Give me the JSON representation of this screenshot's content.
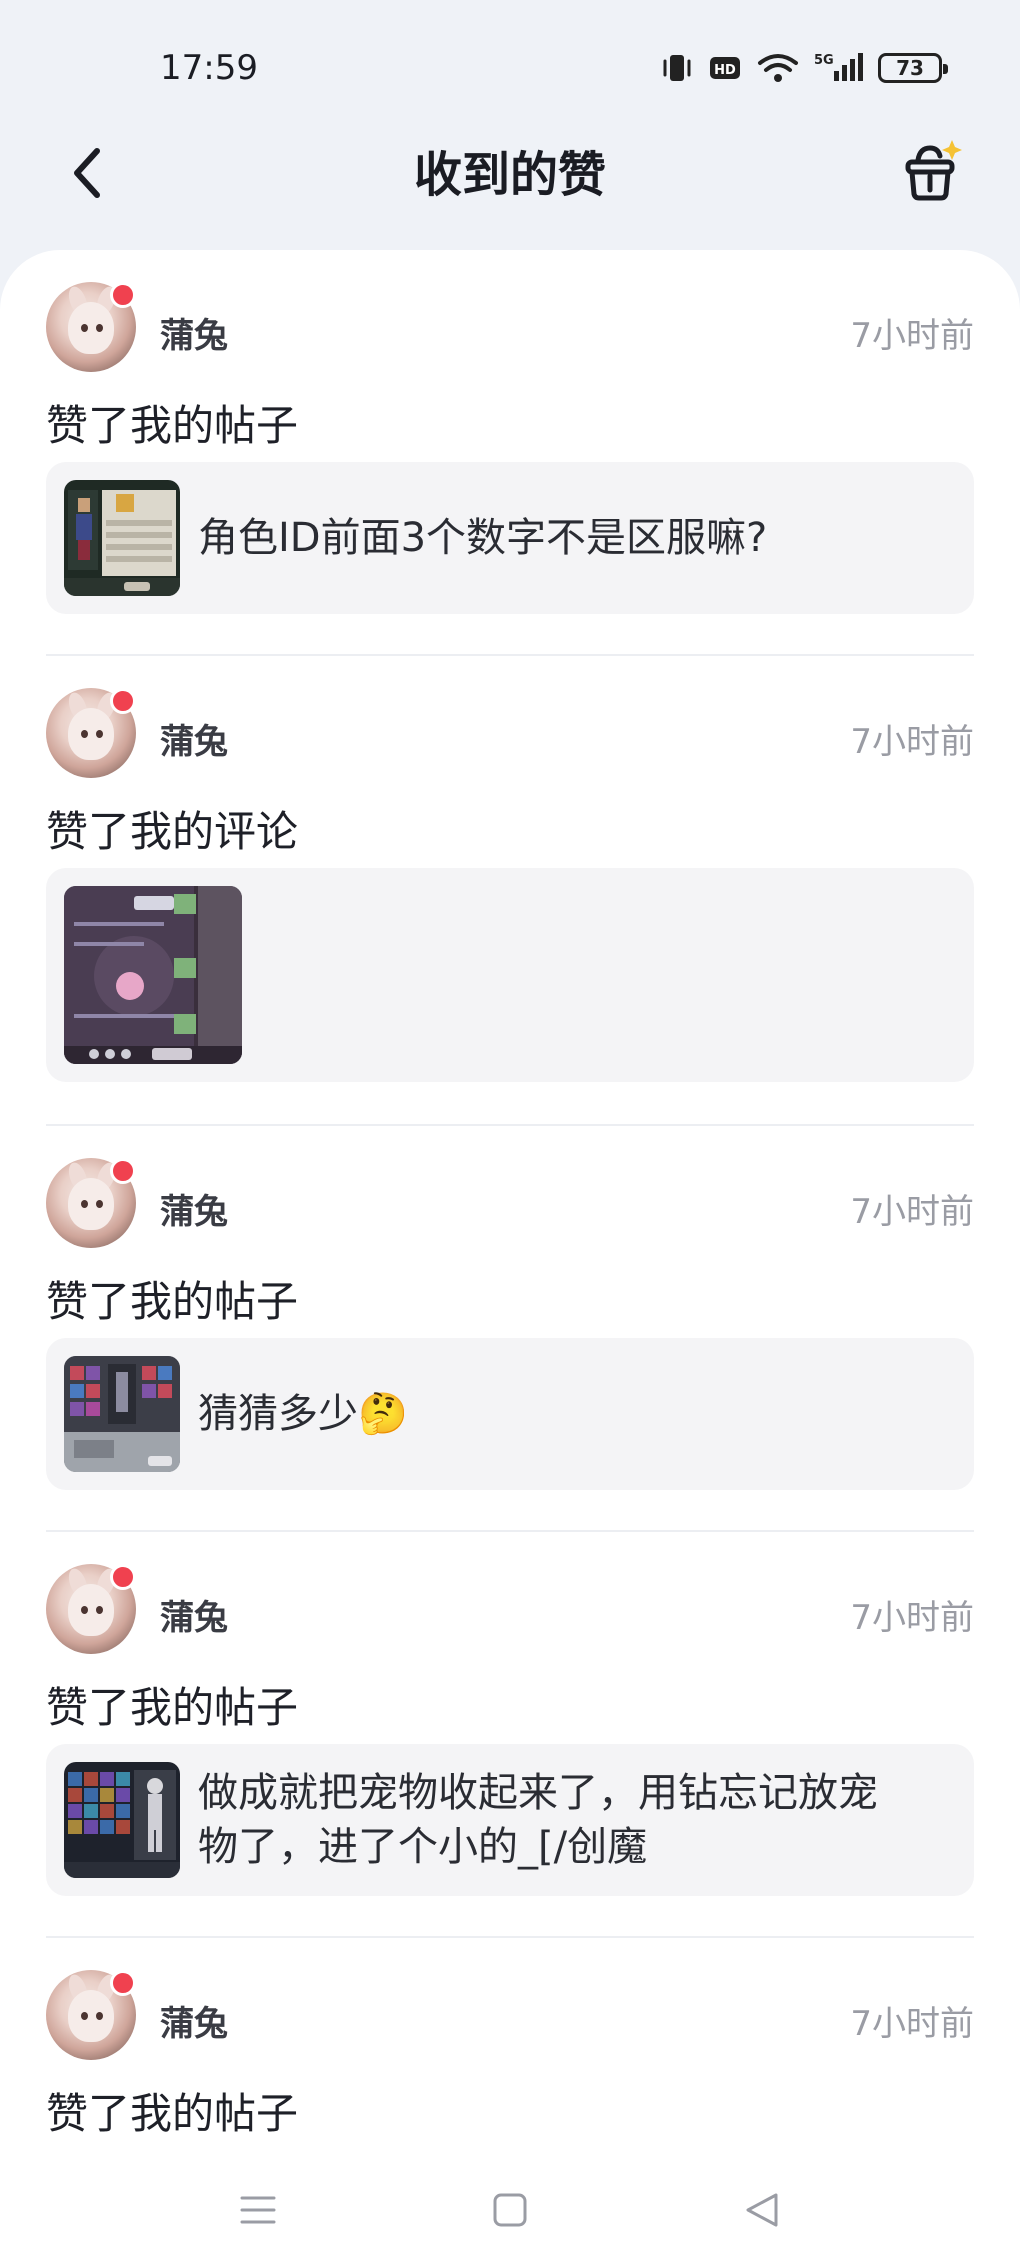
{
  "status_bar": {
    "time": "17:59",
    "network": "5G",
    "battery": "73",
    "icons": [
      "vibrate-icon",
      "hd-icon",
      "wifi-icon",
      "signal-icon",
      "battery-icon"
    ]
  },
  "header": {
    "title": "收到的赞",
    "back_icon": "chevron-left-icon",
    "gift_icon": "gift-basket-icon"
  },
  "items": [
    {
      "user": "蒲兔",
      "time": "7小时前",
      "action": "赞了我的帖子",
      "post_text": "角色ID前面3个数字不是区服嘛?"
    },
    {
      "user": "蒲兔",
      "time": "7小时前",
      "action": "赞了我的评论",
      "post_text": ""
    },
    {
      "user": "蒲兔",
      "time": "7小时前",
      "action": "赞了我的帖子",
      "post_text": "猜猜多少",
      "emoji": "🤔"
    },
    {
      "user": "蒲兔",
      "time": "7小时前",
      "action": "赞了我的帖子",
      "post_text_line1": "做成就把宠物收起来了，用钻忘记放宠",
      "post_text_line2": "物了，进了个小的_[/创魔"
    },
    {
      "user": "蒲兔",
      "time": "7小时前",
      "action": "赞了我的帖子"
    }
  ],
  "colors": {
    "background": "#eff2f7",
    "card": "#f4f4f6",
    "unread_dot": "#f0414f",
    "muted_text": "#9a9ca4"
  },
  "system_nav": [
    "menu-icon",
    "home-icon",
    "back-triangle-icon"
  ]
}
